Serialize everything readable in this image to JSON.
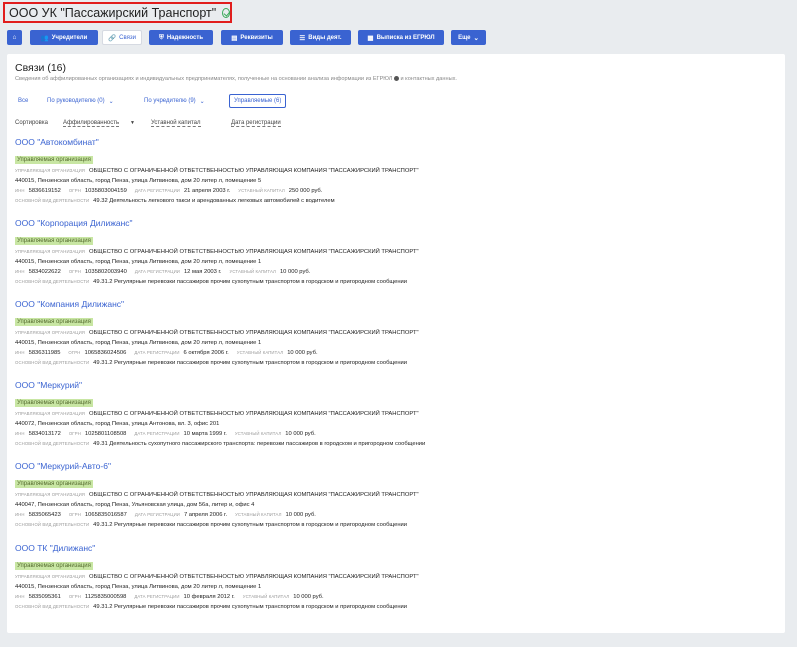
{
  "header": {
    "title": "ООО УК \"Пассажирский Транспорт\"",
    "verified_icon": "check-circle-icon"
  },
  "toolbar": {
    "buttons": [
      {
        "label": "",
        "icon": "home-icon",
        "active": false
      },
      {
        "label": "Учредители",
        "icon": "users-icon",
        "active": false
      },
      {
        "label": "Связи",
        "icon": "link-icon",
        "active": true
      },
      {
        "label": "Надежность",
        "icon": "shield-icon",
        "active": false
      },
      {
        "label": "Реквизиты",
        "icon": "document-icon",
        "active": false
      },
      {
        "label": "Виды деят.",
        "icon": "list-icon",
        "active": false
      },
      {
        "label": "Выписка из ЕГРЮЛ",
        "icon": "doc-list-icon",
        "active": false
      },
      {
        "label": "Еще",
        "icon": "chevron-down-icon",
        "active": false
      }
    ]
  },
  "section": {
    "title": "Связи (16)",
    "subtitle": "Сведения об аффилированных организациях и индивидуальных предпринимателях, полученные на основании анализа информации из ЕГРЮЛ",
    "subtitle_tail": "и контактных данных."
  },
  "filters": [
    {
      "label": "Все",
      "active": false,
      "dropdown": false
    },
    {
      "label": "По руководителю (0)",
      "active": false,
      "dropdown": true
    },
    {
      "label": "По учредителю (9)",
      "active": false,
      "dropdown": true
    },
    {
      "label": "Управляемые (6)",
      "active": true,
      "dropdown": false
    }
  ],
  "sort": {
    "label": "Сортировка",
    "options": [
      "Аффилированность",
      "Уставной капитал",
      "Дата регистрации"
    ],
    "active_index": 0
  },
  "labels": {
    "mgmt": "Управляющая организация",
    "inn": "ИНН",
    "ogrn": "ОГРН",
    "reg_date": "Дата регистрации",
    "capital": "Уставный капитал",
    "activity": "Основной вид деятельности"
  },
  "entries": [
    {
      "name": "ООО \"Автокомбинат\"",
      "badge": "Управляемая организация",
      "mgmt_org": "ОБЩЕСТВО С ОГРАНИЧЕННОЙ ОТВЕТСТВЕННОСТЬЮ УПРАВЛЯЮЩАЯ КОМПАНИЯ \"ПАССАЖИРСКИЙ ТРАНСПОРТ\"",
      "address": "440015, Пензенская область, город Пенза, улица Литвинова, дом 20 литер л, помещение 5",
      "inn": "5836619152",
      "ogrn": "1035803004159",
      "reg_date": "21 апреля 2003 г.",
      "capital": "250 000 руб.",
      "activity": "49.32 Деятельность легкового такси и арендованных легковых автомобилей с водителем"
    },
    {
      "name": "ООО \"Корпорация Дилижанс\"",
      "badge": "Управляемая организация",
      "mgmt_org": "ОБЩЕСТВО С ОГРАНИЧЕННОЙ ОТВЕТСТВЕННОСТЬЮ УПРАВЛЯЮЩАЯ КОМПАНИЯ \"ПАССАЖИРСКИЙ ТРАНСПОРТ\"",
      "address": "440015, Пензенская область, город Пенза, улица Литвинова, дом 20 литер л, помещение 1",
      "inn": "5834022622",
      "ogrn": "1035802003940",
      "reg_date": "12 мая 2003 г.",
      "capital": "10 000 руб.",
      "activity": "49.31.2 Регулярные перевозки пассажиров прочим сухопутным транспортом в городском и пригородном сообщении"
    },
    {
      "name": "ООО \"Компания Дилижанс\"",
      "badge": "Управляемая организация",
      "mgmt_org": "ОБЩЕСТВО С ОГРАНИЧЕННОЙ ОТВЕТСТВЕННОСТЬЮ УПРАВЛЯЮЩАЯ КОМПАНИЯ \"ПАССАЖИРСКИЙ ТРАНСПОРТ\"",
      "address": "440015, Пензенская область, город Пенза, улица Литвинова, дом 20 литер л, помещение 1",
      "inn": "5836311985",
      "ogrn": "1065836024506",
      "reg_date": "6 октября 2006 г.",
      "capital": "10 000 руб.",
      "activity": "49.31.2 Регулярные перевозки пассажиров прочим сухопутным транспортом в городском и пригородном сообщении"
    },
    {
      "name": "ООО \"Меркурий\"",
      "badge": "Управляемая организация",
      "mgmt_org": "ОБЩЕСТВО С ОГРАНИЧЕННОЙ ОТВЕТСТВЕННОСТЬЮ УПРАВЛЯЮЩАЯ КОМПАНИЯ \"ПАССАЖИРСКИЙ ТРАНСПОРТ\"",
      "address": "440072, Пензенская область, город Пенза, улица Антонова, вл. 3, офис 201",
      "inn": "5834013172",
      "ogrn": "1025801108508",
      "reg_date": "10 марта 1999 г.",
      "capital": "10 000 руб.",
      "activity": "49.31 Деятельность сухопутного пассажирского транспорта: перевозки пассажиров в городском и пригородном сообщении"
    },
    {
      "name": "ООО \"Меркурий-Авто-6\"",
      "badge": "Управляемая организация",
      "mgmt_org": "ОБЩЕСТВО С ОГРАНИЧЕННОЙ ОТВЕТСТВЕННОСТЬЮ УПРАВЛЯЮЩАЯ КОМПАНИЯ \"ПАССАЖИРСКИЙ ТРАНСПОРТ\"",
      "address": "440047, Пензенская область, город Пенза, Ульяновская улица, дом 56а, литер и, офис 4",
      "inn": "5835065423",
      "ogrn": "1065835016587",
      "reg_date": "7 апреля 2006 г.",
      "capital": "10 000 руб.",
      "activity": "49.31.2 Регулярные перевозки пассажиров прочим сухопутным транспортом в городском и пригородном сообщении"
    },
    {
      "name": "ООО ТК \"Дилижанс\"",
      "badge": "Управляемая организация",
      "mgmt_org": "ОБЩЕСТВО С ОГРАНИЧЕННОЙ ОТВЕТСТВЕННОСТЬЮ УПРАВЛЯЮЩАЯ КОМПАНИЯ \"ПАССАЖИРСКИЙ ТРАНСПОРТ\"",
      "address": "440015, Пензенская область, город Пенза, улица Литвинова, дом 20 литер л, помещение 1",
      "inn": "5835095361",
      "ogrn": "1125835000598",
      "reg_date": "10 февраля 2012 г.",
      "capital": "10 000 руб.",
      "activity": "49.31.2 Регулярные перевозки пассажиров прочим сухопутным транспортом в городском и пригородном сообщении"
    }
  ]
}
